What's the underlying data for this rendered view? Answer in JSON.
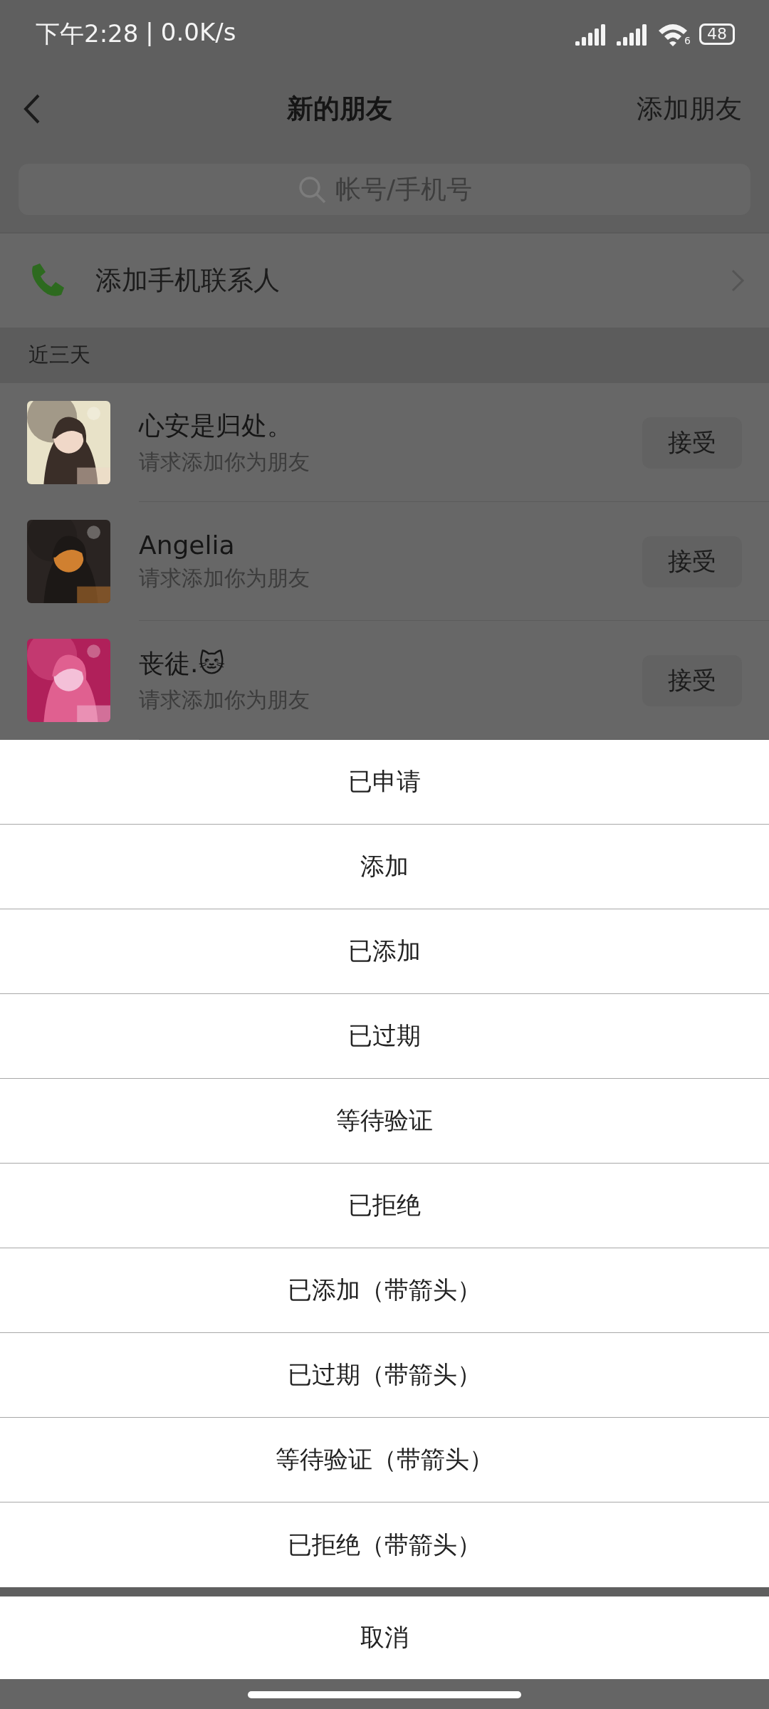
{
  "status_bar": {
    "time": "下午2:28",
    "separator": "|",
    "speed": "0.0K/s",
    "wifi_badge": "6",
    "battery": "48"
  },
  "nav": {
    "title": "新的朋友",
    "action": "添加朋友"
  },
  "search": {
    "placeholder": "帐号/手机号"
  },
  "add_contacts": {
    "label": "添加手机联系人"
  },
  "section": {
    "title": "近三天"
  },
  "requests": [
    {
      "name": "心安是归处。",
      "message": "请求添加你为朋友",
      "button": "接受",
      "kind": "picture"
    },
    {
      "name": "Angelia",
      "message": "请求添加你为朋友",
      "button": "接受",
      "kind": "picture"
    },
    {
      "name": "丧徒.🐱",
      "message": "请求添加你为朋友",
      "button": "接受",
      "kind": "picture"
    }
  ],
  "action_sheet": {
    "options": [
      "已申请",
      "添加",
      "已添加",
      "已过期",
      "等待验证",
      "已拒绝",
      "已添加（带箭头）",
      "已过期（带箭头）",
      "等待验证（带箭头）",
      "已拒绝（带箭头）"
    ],
    "cancel": "取消"
  }
}
